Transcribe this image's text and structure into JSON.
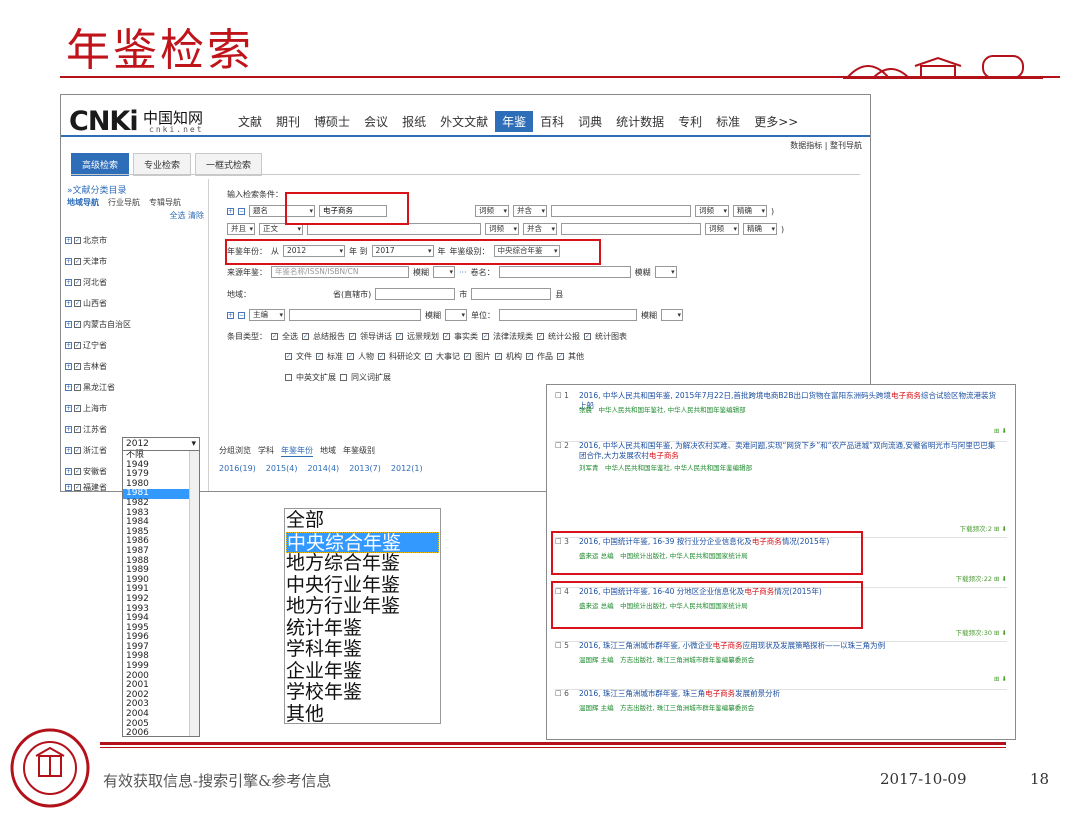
{
  "slide": {
    "title": "年鉴检索",
    "footer_text": "有效获取信息-搜索引擎&参考信息",
    "date": "2017-10-09",
    "page": "18"
  },
  "cnki": {
    "logo_word": "CNKi",
    "logo_cn": "中国知网",
    "logo_sub": "cnki.net",
    "nav": [
      "文献",
      "期刊",
      "博硕士",
      "会议",
      "报纸",
      "外文文献",
      "年鉴",
      "百科",
      "词典",
      "统计数据",
      "专利",
      "标准",
      "更多>>"
    ],
    "nav_active_index": 6,
    "quicklinks": "数据指标 | 整刊导航",
    "tabs": [
      "高级检索",
      "专业检索",
      "一框式检索"
    ],
    "active_tab": "高级检索"
  },
  "sidebar": {
    "title": "»文献分类目录",
    "tabs": [
      "地域导航",
      "行业导航",
      "专辑导航"
    ],
    "links": "全选 清除",
    "regions": [
      "北京市",
      "天津市",
      "河北省",
      "山西省",
      "内蒙古自治区",
      "辽宁省",
      "吉林省",
      "黑龙江省",
      "上海市",
      "江苏省",
      "浙江省",
      "安徽省",
      "福建省"
    ]
  },
  "form": {
    "label": "输入检索条件：",
    "row1": {
      "field": "题名",
      "value": "电子商务",
      "freq": "词频",
      "logic": "并含",
      "freq2": "词频",
      "match": "精确"
    },
    "row2": {
      "op": "并且",
      "field": "正文",
      "freq": "词频",
      "logic": "并含",
      "freq2": "词频",
      "match": "精确"
    },
    "year_label": "年鉴年份：",
    "from_word": "从",
    "year_from": "2012",
    "year_to_word": "年 到",
    "year_to": "2017",
    "year_word": "年",
    "level_label": "年鉴级别：",
    "level": "中央综合年鉴",
    "source_label": "来源年鉴：",
    "source_placeholder": "年鉴名称/ISSN/ISBN/CN",
    "source_match": "模糊",
    "volume_label": "卷名：",
    "volume_match": "模糊",
    "area_label": "地域：",
    "province_word": "省(直辖市)",
    "city_word": "市",
    "county_word": "县",
    "editor_field": "主编",
    "editor_match": "模糊",
    "unit_label": "单位：",
    "unit_match": "模糊",
    "types_label": "条目类型：",
    "types_row1": [
      "全选",
      "总结报告",
      "领导讲话",
      "远景规划",
      "事实类",
      "法律法规类",
      "统计公报",
      "统计图表"
    ],
    "types_row2": [
      "文件",
      "标准",
      "人物",
      "科研论文",
      "大事记",
      "图片",
      "机构",
      "作品",
      "其他"
    ],
    "expand": [
      "中英文扩展",
      "同义词扩展"
    ]
  },
  "group": {
    "tabs": [
      "分组浏览",
      "学科",
      "年鉴年份",
      "地域",
      "年鉴级别"
    ],
    "active": "年鉴年份",
    "counts": [
      "2016(19)",
      "2015(4)",
      "2014(4)",
      "2013(7)",
      "2012(1)"
    ]
  },
  "year_dropdown": {
    "current": "2012",
    "options": [
      "不限",
      "1949",
      "1979",
      "1980",
      "1981",
      "1982",
      "1983",
      "1984",
      "1985",
      "1986",
      "1987",
      "1988",
      "1989",
      "1990",
      "1991",
      "1992",
      "1993",
      "1994",
      "1995",
      "1996",
      "1997",
      "1998",
      "1999",
      "2000",
      "2001",
      "2002",
      "2003",
      "2004",
      "2005",
      "2006"
    ],
    "selected": "1981"
  },
  "level_list": {
    "options": [
      "全部",
      "中央综合年鉴",
      "地方综合年鉴",
      "中央行业年鉴",
      "地方行业年鉴",
      "统计年鉴",
      "学科年鉴",
      "企业年鉴",
      "学校年鉴",
      "其他"
    ],
    "selected": "中央综合年鉴"
  },
  "results": [
    {
      "num": "1",
      "pre": "2016, 中华人民共和国年鉴, 2015年7月22日,首批跨境电商B2B出口货物在富阳东洲码头跨境",
      "hit": "电子商务",
      "post": "综合试验区物流港装货上船",
      "meta": "张晨　中华人民共和国年鉴社, 中华人民共和国年鉴编辑部",
      "tools": "⊞ ⬇"
    },
    {
      "num": "2",
      "pre": "2016, 中华人民共和国年鉴, 为解决农村买难、卖难问题,实现“网货下乡”和“农产品进城”双向流通,安徽省明光市与阿里巴巴集团合作,大力发展农村",
      "hit": "电子商务",
      "post": "",
      "meta": "刘军青　中华人民共和国年鉴社, 中华人民共和国年鉴编辑部",
      "tools": "下载频次:2 ⊞ ⬇"
    },
    {
      "num": "3",
      "pre": "2016, 中国统计年鉴, 16-39 按行业分企业信息化及",
      "hit": "电子商务",
      "post": "情况(2015年)",
      "meta": "盛来运 总编　中国统计出版社, 中华人民共和国国家统计局",
      "tools": "下载频次:22 ⊞ ⬇"
    },
    {
      "num": "4",
      "pre": "2016, 中国统计年鉴, 16-40 分地区企业信息化及",
      "hit": "电子商务",
      "post": "情况(2015年)",
      "meta": "盛来运 总编　中国统计出版社, 中华人民共和国国家统计局",
      "tools": "下载频次:30 ⊞ ⬇"
    },
    {
      "num": "5",
      "pre": "2016, 珠江三角洲城市群年鉴, 小微企业",
      "hit": "电子商务",
      "post": "应用现状及发展策略探析——以珠三角为例",
      "meta": "温国辉 主编　方志出版社, 珠江三角洲城市群年鉴编纂委员会",
      "tools": "⊞ ⬇"
    },
    {
      "num": "6",
      "pre": "2016, 珠江三角洲城市群年鉴, 珠三角",
      "hit": "电子商务",
      "post": "发展前景分析",
      "meta": "温国辉 主编　方志出版社, 珠江三角洲城市群年鉴编纂委员会",
      "tools": ""
    }
  ]
}
